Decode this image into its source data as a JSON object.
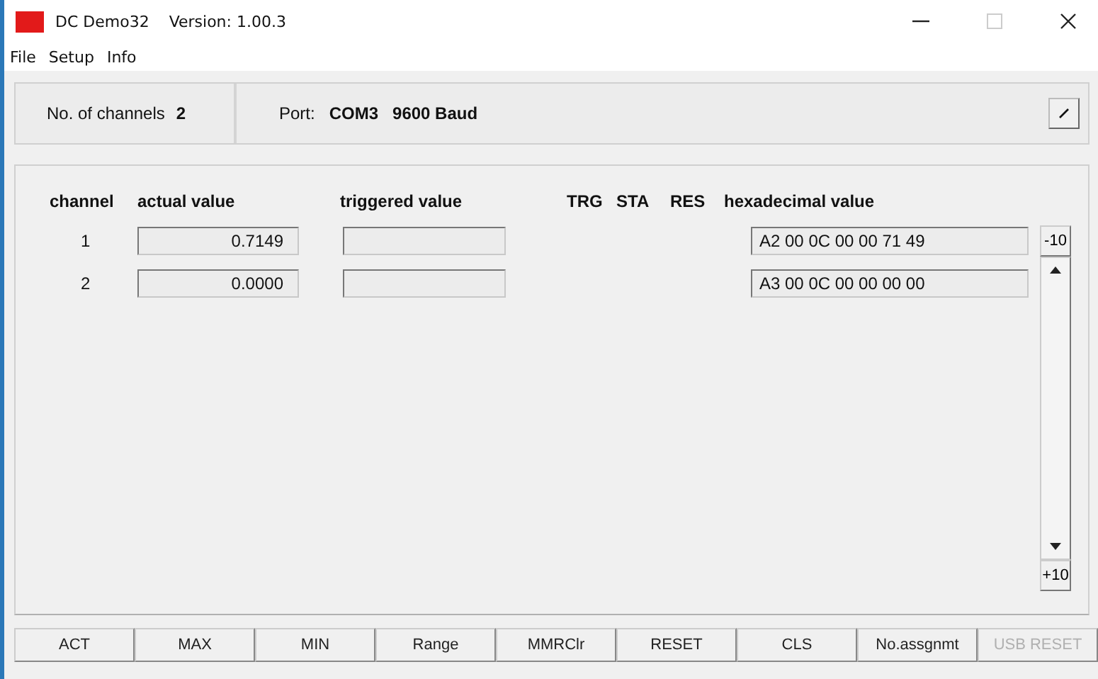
{
  "window": {
    "title": "DC Demo32",
    "version": "Version: 1.00.3"
  },
  "menu": [
    "File",
    "Setup",
    "Info"
  ],
  "header": {
    "channels_label": "No. of channels",
    "channels_value": "2",
    "port_label": "Port:",
    "port_value": "COM3",
    "baud": "9600 Baud"
  },
  "table": {
    "columns": [
      "channel",
      "actual value",
      "triggered value",
      "TRG",
      "STA",
      "RES",
      "hexadecimal value"
    ],
    "rows": [
      {
        "channel": "1",
        "actual": "0.7149",
        "hex": "A2 00 0C 00 00 71 49"
      },
      {
        "channel": "2",
        "actual": "0.0000",
        "hex": "A3 00 0C 00 00 00 00"
      }
    ]
  },
  "scroll": {
    "up_label": "-10",
    "down_label": "+10"
  },
  "buttons": [
    {
      "label": "ACT",
      "disabled": false
    },
    {
      "label": "MAX",
      "disabled": false
    },
    {
      "label": "MIN",
      "disabled": false
    },
    {
      "label": "Range",
      "disabled": false
    },
    {
      "label": "MMRClr",
      "disabled": false
    },
    {
      "label": "RESET",
      "disabled": false
    },
    {
      "label": "CLS",
      "disabled": false
    },
    {
      "label": "No.assgnmt",
      "disabled": false
    },
    {
      "label": "USB RESET",
      "disabled": true
    }
  ]
}
